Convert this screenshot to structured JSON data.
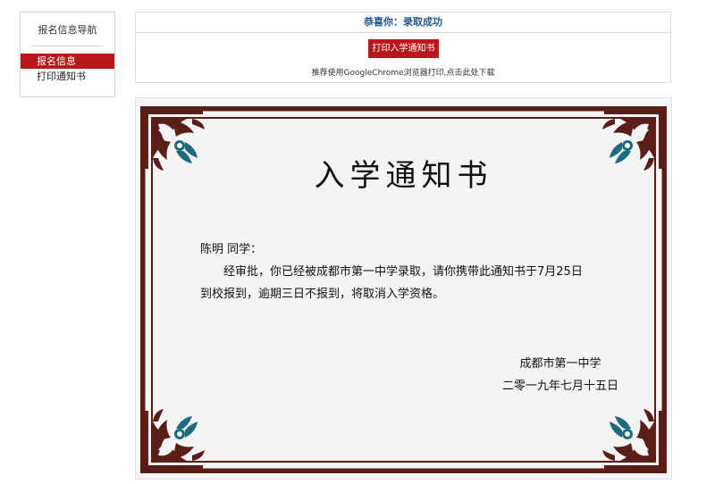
{
  "sidebar": {
    "title": "报名信息导航",
    "items": [
      {
        "label": "报名信息",
        "active": true
      },
      {
        "label": "打印通知书",
        "active": false
      }
    ]
  },
  "top_panel": {
    "header": "恭喜你：录取成功",
    "print_button": "打印入学通知书",
    "tip": "推荐使用GoogleChrome浏览器打印,点击此处下载"
  },
  "certificate": {
    "title": "入学通知书",
    "salutation": "陈明 同学：",
    "body": "经审批，你已经被成都市第一中学录取，请你携带此通知书于7月25日到校报到，逾期三日不报到，将取消入学资格。",
    "school": "成都市第一中学",
    "date": "二零一九年七月十五日"
  },
  "colors": {
    "accent": "#b8181c",
    "header_text": "#1f5a8c",
    "frame": "#5a1e18"
  }
}
